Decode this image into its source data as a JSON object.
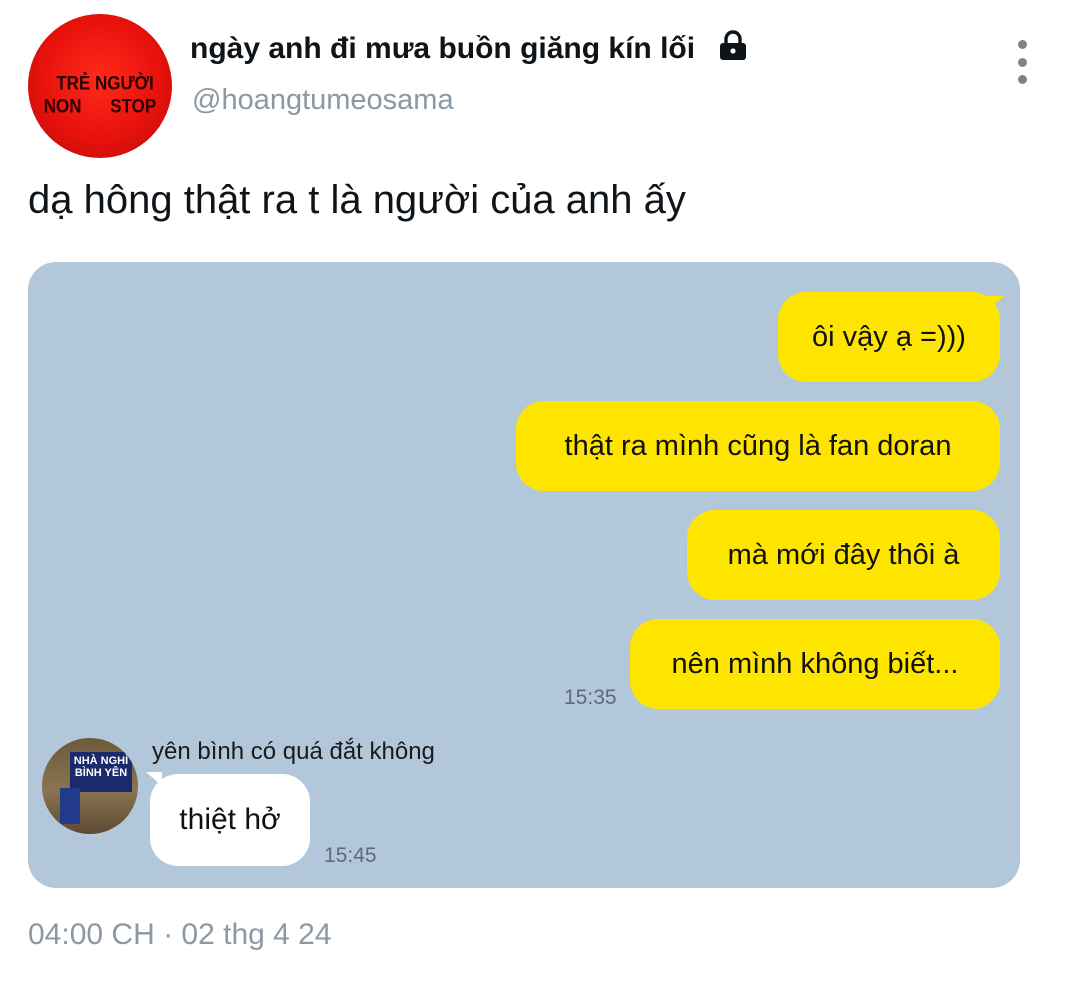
{
  "author": {
    "display_name": "ngày anh đi mưa buồn giăng kín lối",
    "handle": "@hoangtumeosama",
    "avatar_text_line1": "TRẺ NGƯỜI",
    "avatar_text_line2": "NON STOP",
    "protected_icon": "lock-icon"
  },
  "tweet": {
    "text": "dạ hông thật ra t là người của anh ấy",
    "timestamp": "04:00 CH · 02 thg 4 24"
  },
  "chat": {
    "sent_messages": [
      "ôi vậy ạ =)))",
      "thật ra mình cũng là fan doran",
      "mà mới đây thôi à",
      "nên mình không biết..."
    ],
    "sent_time": "15:35",
    "friend_name": "yên bình có quá đắt không",
    "friend_avatar_text": "NHÀ NGHỈ BÌNH YÊN",
    "received_message": "thiệt hở",
    "received_time": "15:45",
    "colors": {
      "background": "#b2c7da",
      "sent_bubble": "#fee500",
      "received_bubble": "#ffffff"
    }
  }
}
